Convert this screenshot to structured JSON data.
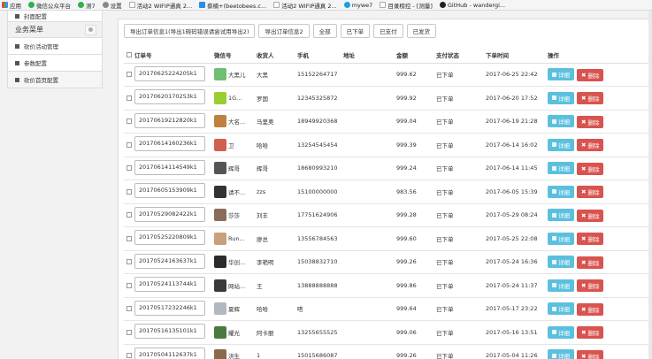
{
  "bookmarks": [
    {
      "label": "应用",
      "icon": "apps-grid-icon"
    },
    {
      "label": "微信公众平台",
      "icon": "wechat-icon"
    },
    {
      "label": "测7",
      "icon": "wechat-icon"
    },
    {
      "label": "设置",
      "icon": "gear-icon"
    },
    {
      "label": "活动2 WIFIP通真 2...",
      "icon": "page-icon"
    },
    {
      "label": "蔡楠+(beetobees.c...",
      "icon": "blue-icon"
    },
    {
      "label": "活动2 WIFIP通真 2...",
      "icon": "page-icon"
    },
    {
      "label": "mywe7",
      "icon": "fish-icon"
    },
    {
      "label": "目录榜控 - [测量]",
      "icon": "page-icon"
    },
    {
      "label": "GitHub - wandergi...",
      "icon": "github-icon"
    }
  ],
  "sidebar": {
    "top_item": "封面配置",
    "section_title": "业务菜单",
    "items": [
      {
        "label": "砍价活动管理"
      },
      {
        "label": "参数配置"
      },
      {
        "label": "砍价首页配置"
      }
    ]
  },
  "toolbar": {
    "buttons": [
      "导出订单信息1(导出1碗码错误请尝试用导出2)",
      "导出订单信息2",
      "全部",
      "已下单",
      "已支付",
      "已发货"
    ]
  },
  "table": {
    "headers": [
      "订单号",
      "微信号",
      "收货人",
      "手机",
      "地址",
      "金额",
      "支付状态",
      "下单时间",
      "操作"
    ],
    "edit_label": "详细",
    "delete_label": "删除",
    "rows": [
      {
        "order": "20170625224205k1",
        "wechat": "大黑儿",
        "name": "大黑",
        "phone": "15152264717",
        "address": "",
        "amount": "999.62",
        "status": "已下单",
        "time": "2017-06-25 22:42",
        "avatar_color": "#6fbf73"
      },
      {
        "order": "20170620170253k1",
        "wechat": "1G...",
        "name": "罗国",
        "phone": "12345325872",
        "address": "",
        "amount": "999.92",
        "status": "已下单",
        "time": "2017-06-20 17:52",
        "avatar_color": "#9acd32"
      },
      {
        "order": "20170619212820k1",
        "wechat": "大名...",
        "name": "马里奥",
        "phone": "18949920368",
        "address": "",
        "amount": "999.04",
        "status": "已下单",
        "time": "2017-06-19 21:28",
        "avatar_color": "#c08040"
      },
      {
        "order": "20170614160236k1",
        "wechat": "卫",
        "name": "哈哈",
        "phone": "13254545454",
        "address": "",
        "amount": "999.39",
        "status": "已下单",
        "time": "2017-06-14 16:02",
        "avatar_color": "#d06050"
      },
      {
        "order": "20170614114549k1",
        "wechat": "辉哥",
        "name": "辉哥",
        "phone": "18680993210",
        "address": "",
        "amount": "999.24",
        "status": "已下单",
        "time": "2017-06-14 11:45",
        "avatar_color": "#555555"
      },
      {
        "order": "20170605153909k1",
        "wechat": "请不...",
        "name": "zzs",
        "phone": "15100000000",
        "address": "",
        "amount": "983.56",
        "status": "已下单",
        "time": "2017-06-05 15:39",
        "avatar_color": "#333333"
      },
      {
        "order": "20170529082422k1",
        "wechat": "莎莎",
        "name": "刘丰",
        "phone": "17751624906",
        "address": "",
        "amount": "999.28",
        "status": "已下单",
        "time": "2017-05-29 08:24",
        "avatar_color": "#8b6b5a"
      },
      {
        "order": "20170525220809k1",
        "wechat": "Run...",
        "name": "廖总",
        "phone": "13556784563",
        "address": "",
        "amount": "999.60",
        "status": "已下单",
        "time": "2017-05-25 22:08",
        "avatar_color": "#c8a07a"
      },
      {
        "order": "20170524163637k1",
        "wechat": "华创...",
        "name": "李艳明",
        "phone": "15038832710",
        "address": "",
        "amount": "999.26",
        "status": "已下单",
        "time": "2017-05-24 16:36",
        "avatar_color": "#2b2b2b"
      },
      {
        "order": "20170524113744k1",
        "wechat": "网站...",
        "name": "王",
        "phone": "13888888888",
        "address": "",
        "amount": "999.86",
        "status": "已下单",
        "time": "2017-05-24 11:37",
        "avatar_color": "#3a3a3a"
      },
      {
        "order": "20170517232246k1",
        "wechat": "夏辉",
        "name": "哈哈",
        "phone": "嗒",
        "address": "",
        "amount": "999.64",
        "status": "已下单",
        "time": "2017-05-17 23:22",
        "avatar_color": "#b0b8c0"
      },
      {
        "order": "20170516135101k1",
        "wechat": "耀光",
        "name": "阿卡丽",
        "phone": "13255655525",
        "address": "",
        "amount": "999.06",
        "status": "已下单",
        "time": "2017-05-16 13:51",
        "avatar_color": "#4a7a40"
      },
      {
        "order": "20170504112637k1",
        "wechat": "洪生",
        "name": "1",
        "phone": "15015686087",
        "address": "",
        "amount": "999.26",
        "status": "已下单",
        "time": "2017-05-04 11:26",
        "avatar_color": "#8a6a4a"
      }
    ]
  },
  "colors": {
    "edit_button": "#5bc0de",
    "delete_button": "#d9534f",
    "sidebar_header_bg": "#f1f1f1"
  }
}
